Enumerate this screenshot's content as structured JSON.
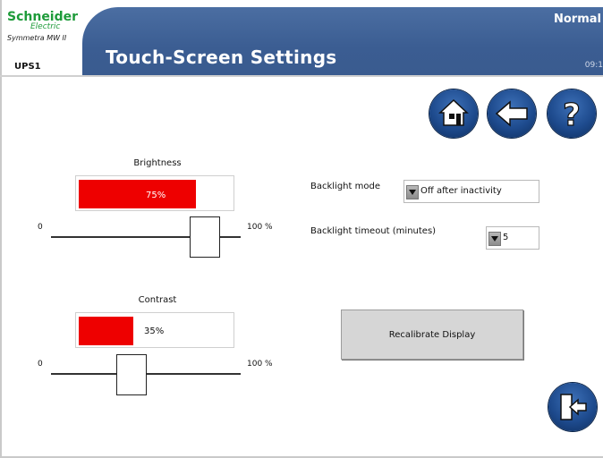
{
  "header": {
    "brand_name": "Schneider",
    "brand_sub": "Electric",
    "product": "Symmetra MW II",
    "unit": "UPS1",
    "title": "Touch-Screen Settings",
    "status": "Normal",
    "time": "09:1"
  },
  "nav": {
    "home": "home-icon",
    "back": "back-arrow-icon",
    "help": "help-icon",
    "exit": "exit-door-icon"
  },
  "brightness": {
    "label": "Brightness",
    "value_text": "75%",
    "value": 75,
    "min_label": "0",
    "max_label": "100 %"
  },
  "contrast": {
    "label": "Contrast",
    "value_text": "35%",
    "value": 35,
    "min_label": "0",
    "max_label": "100 %"
  },
  "backlight_mode": {
    "label": "Backlight mode",
    "value": "Off after inactivity"
  },
  "backlight_timeout": {
    "label": "Backlight timeout (minutes)",
    "value": "5"
  },
  "recalibrate": {
    "label": "Recalibrate Display"
  },
  "colors": {
    "header": "#3b5d92",
    "accent_fill": "#ee0000",
    "brand_green": "#1e9b3a"
  }
}
